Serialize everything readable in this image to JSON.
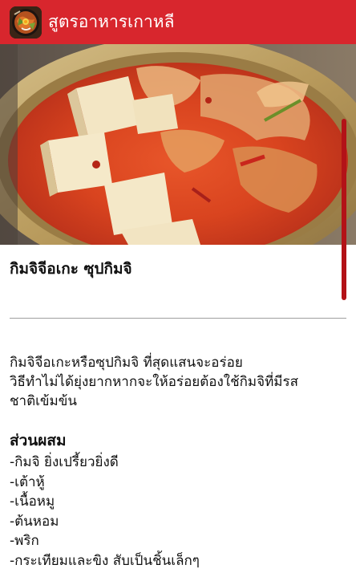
{
  "app_bar": {
    "title": "สูตรอาหารเกาหลี",
    "icon": "app-logo-bibimbap",
    "background": "#d8262d"
  },
  "hero_image": {
    "subject": "kimchi-jjigae-stew-photo"
  },
  "recipe": {
    "title": "กิมจิจีอเกะ ซุปกิมจิ",
    "description_lines": [
      "กิมจิจีอเกะหรือซุปกิมจิ ที่สุดแสนจะอร่อย",
      "วิธีทำไม่ได้ยุ่งยากหากจะให้อร่อยต้องใช้กิมจิที่มีรส",
      "ชาติเข้มข้น"
    ],
    "ingredients_heading": "ส่วนผสม",
    "ingredients": [
      "-กิมจิ ยิ่งเปรี้ยวยิ่งดี",
      "-เต้าหู้",
      "-เนื้อหมู",
      "-ต้นหอม",
      "-พริก",
      "-กระเทียมและขิง สับเป็นชิ้นเล็กๆ"
    ]
  },
  "colors": {
    "accent": "#d8262d",
    "scrollbar": "#b31217",
    "divider": "#9e9e9e"
  }
}
